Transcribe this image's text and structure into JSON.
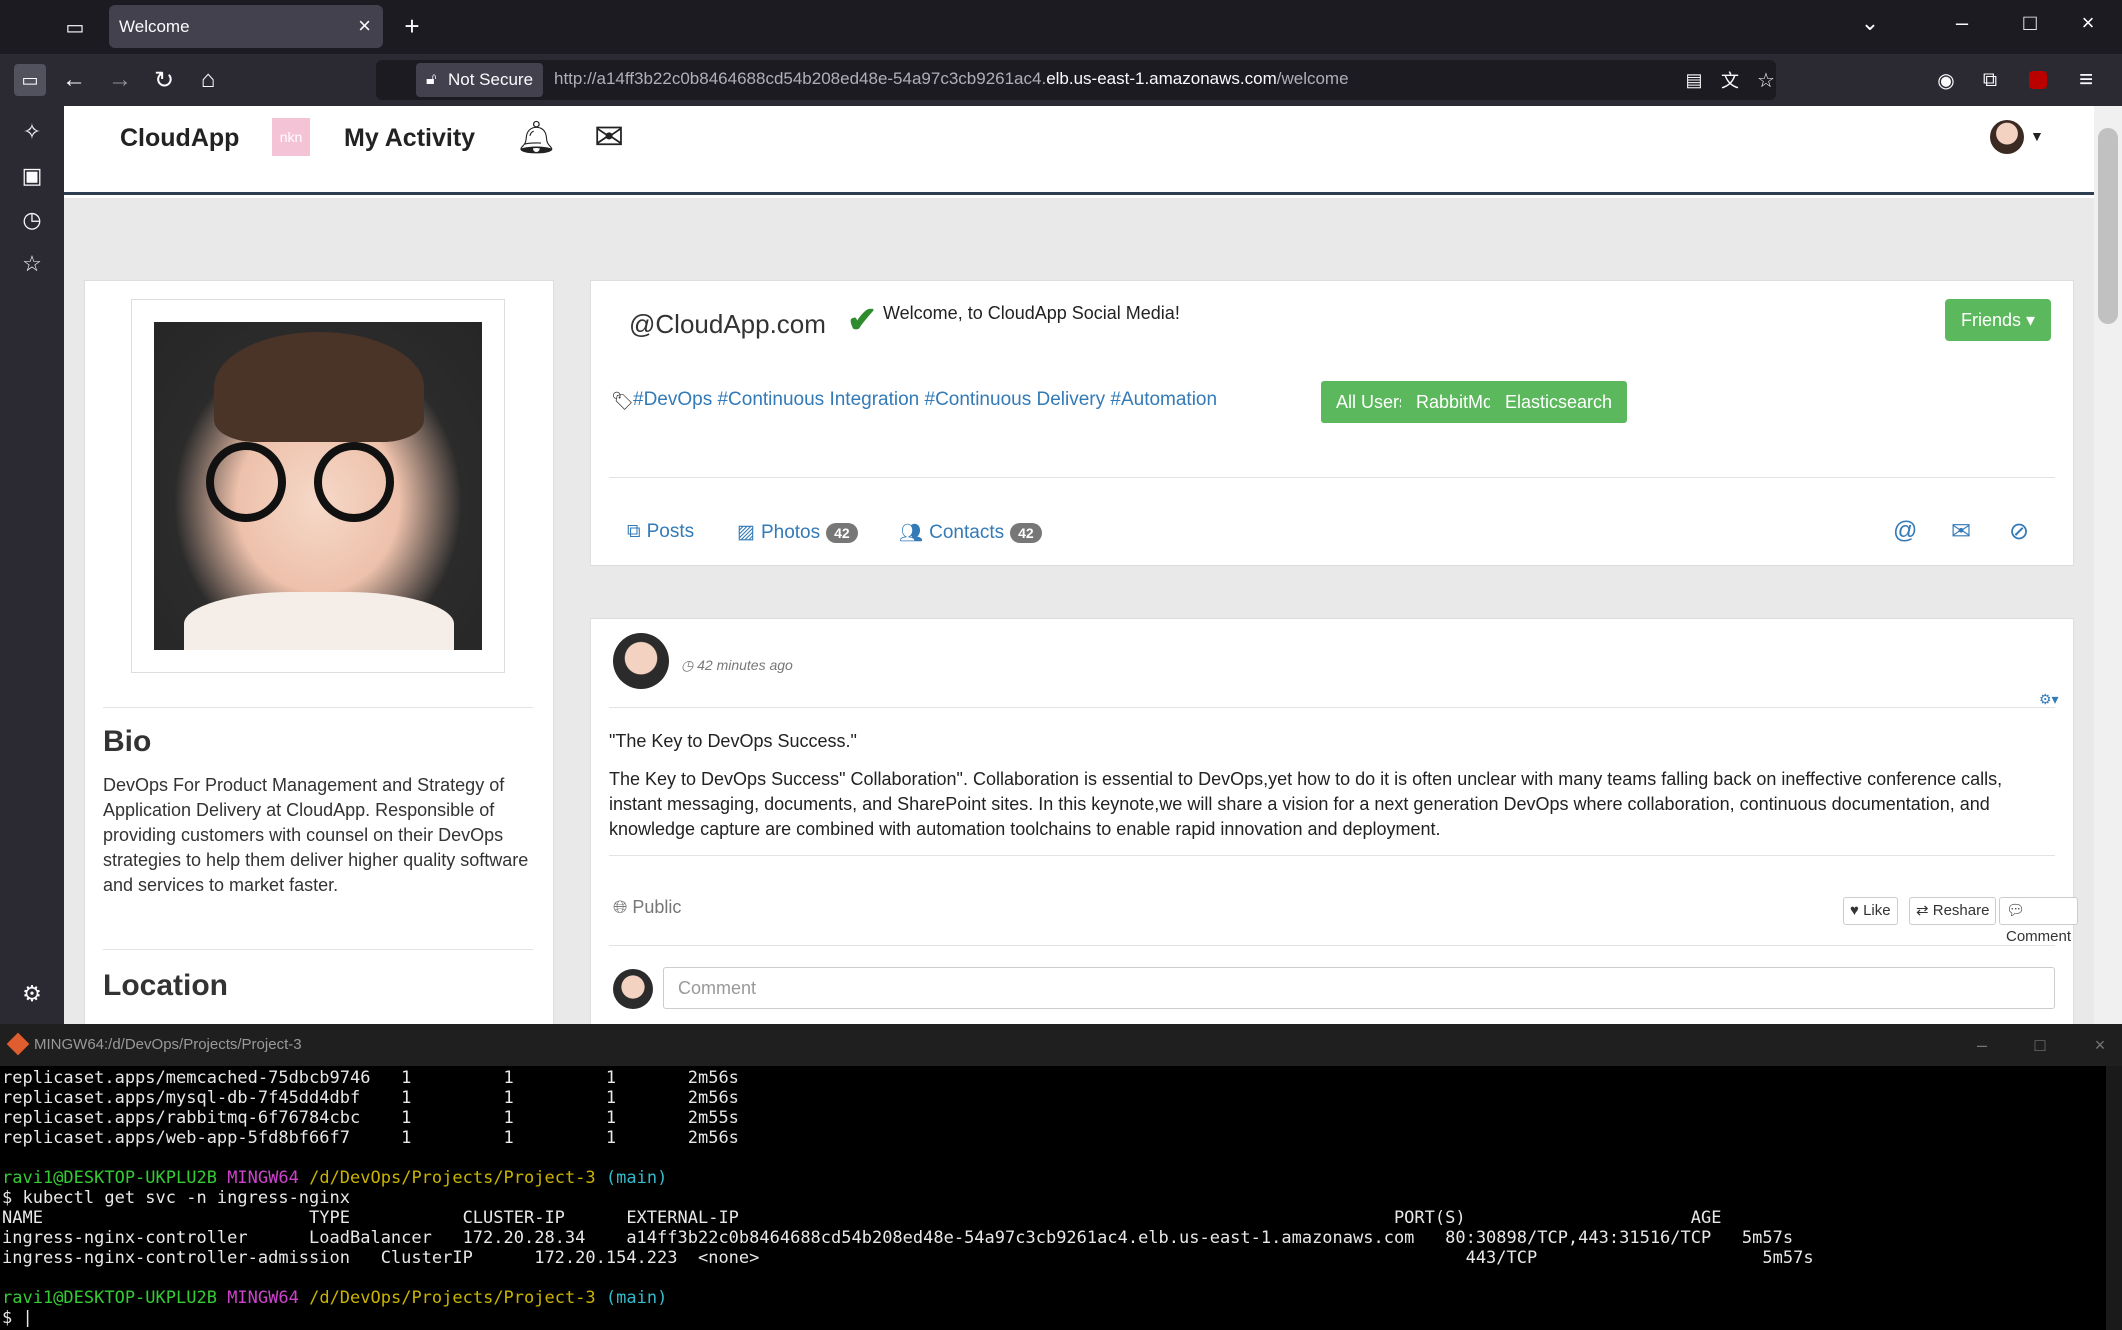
{
  "browser": {
    "tab_title": "Welcome",
    "not_secure": "Not Secure",
    "url_prefix": "http://a14ff3b22c0b8464688cd54b208ed48e-54a97c3cb9261ac4.",
    "url_host": "elb.us-east-1.amazonaws.com",
    "url_path": "/welcome"
  },
  "site": {
    "brand": "CloudApp",
    "logo_text": "nkn",
    "activity": "My Activity"
  },
  "profile": {
    "bio_title": "Bio",
    "bio_text": "DevOps For Product Management and Strategy of Application Delivery at CloudApp. Responsible of providing customers with counsel on their DevOps strategies to help them deliver higher quality software and services to market faster.",
    "location_title": "Location"
  },
  "header": {
    "handle": "@CloudApp.com",
    "welcome": "Welcome, to CloudApp Social Media!",
    "friends": "Friends",
    "tags": "#DevOps #Continuous Integration #Continuous Delivery #Automation",
    "buttons": [
      "All Users",
      "RabbitMq",
      "Elasticsearch"
    ],
    "tabs": [
      {
        "label": "Posts",
        "badge": ""
      },
      {
        "label": "Photos",
        "badge": "42"
      },
      {
        "label": "Contacts",
        "badge": "42"
      }
    ]
  },
  "post": {
    "time": "42 minutes ago",
    "title": "\"The Key to DevOps Success.\"",
    "body": "The Key to DevOps Success\" Collaboration\". Collaboration is essential to DevOps,yet how to do it is often unclear with many teams falling back on ineffective conference calls, instant messaging, documents, and SharePoint sites. In this keynote,we will share a vision for a next generation DevOps where collaboration, continuous documentation, and knowledge capture are combined with automation toolchains to enable rapid innovation and deployment.",
    "visibility": "Public",
    "actions": [
      "Like",
      "Reshare",
      "Comment"
    ],
    "comment_placeholder": "Comment"
  },
  "terminal": {
    "title": "MINGW64:/d/DevOps/Projects/Project-3",
    "rs_lines": [
      "replicaset.apps/memcached-75dbcb9746   1         1         1       2m56s",
      "replicaset.apps/mysql-db-7f45dd4dbf    1         1         1       2m56s",
      "replicaset.apps/rabbitmq-6f76784cbc    1         1         1       2m55s",
      "replicaset.apps/web-app-5fd8bf66f7     1         1         1       2m56s"
    ],
    "prompt_user": "ravi1@DESKTOP-UKPLU2B",
    "prompt_env": "MINGW64",
    "prompt_path": "/d/DevOps/Projects/Project-3",
    "prompt_branch": "(main)",
    "command": "$ kubectl get svc -n ingress-nginx",
    "svc_header": "NAME                          TYPE           CLUSTER-IP      EXTERNAL-IP                                                                PORT(S)                      AGE",
    "svc_row1": "ingress-nginx-controller      LoadBalancer   172.20.28.34    a14ff3b22c0b8464688cd54b208ed48e-54a97c3cb9261ac4.elb.us-east-1.amazonaws.com   80:30898/TCP,443:31516/TCP   5m57s",
    "svc_row2": "ingress-nginx-controller-admission   ClusterIP      172.20.154.223  <none>                                                                     443/TCP                      5m57s",
    "final_prompt": "$ "
  }
}
